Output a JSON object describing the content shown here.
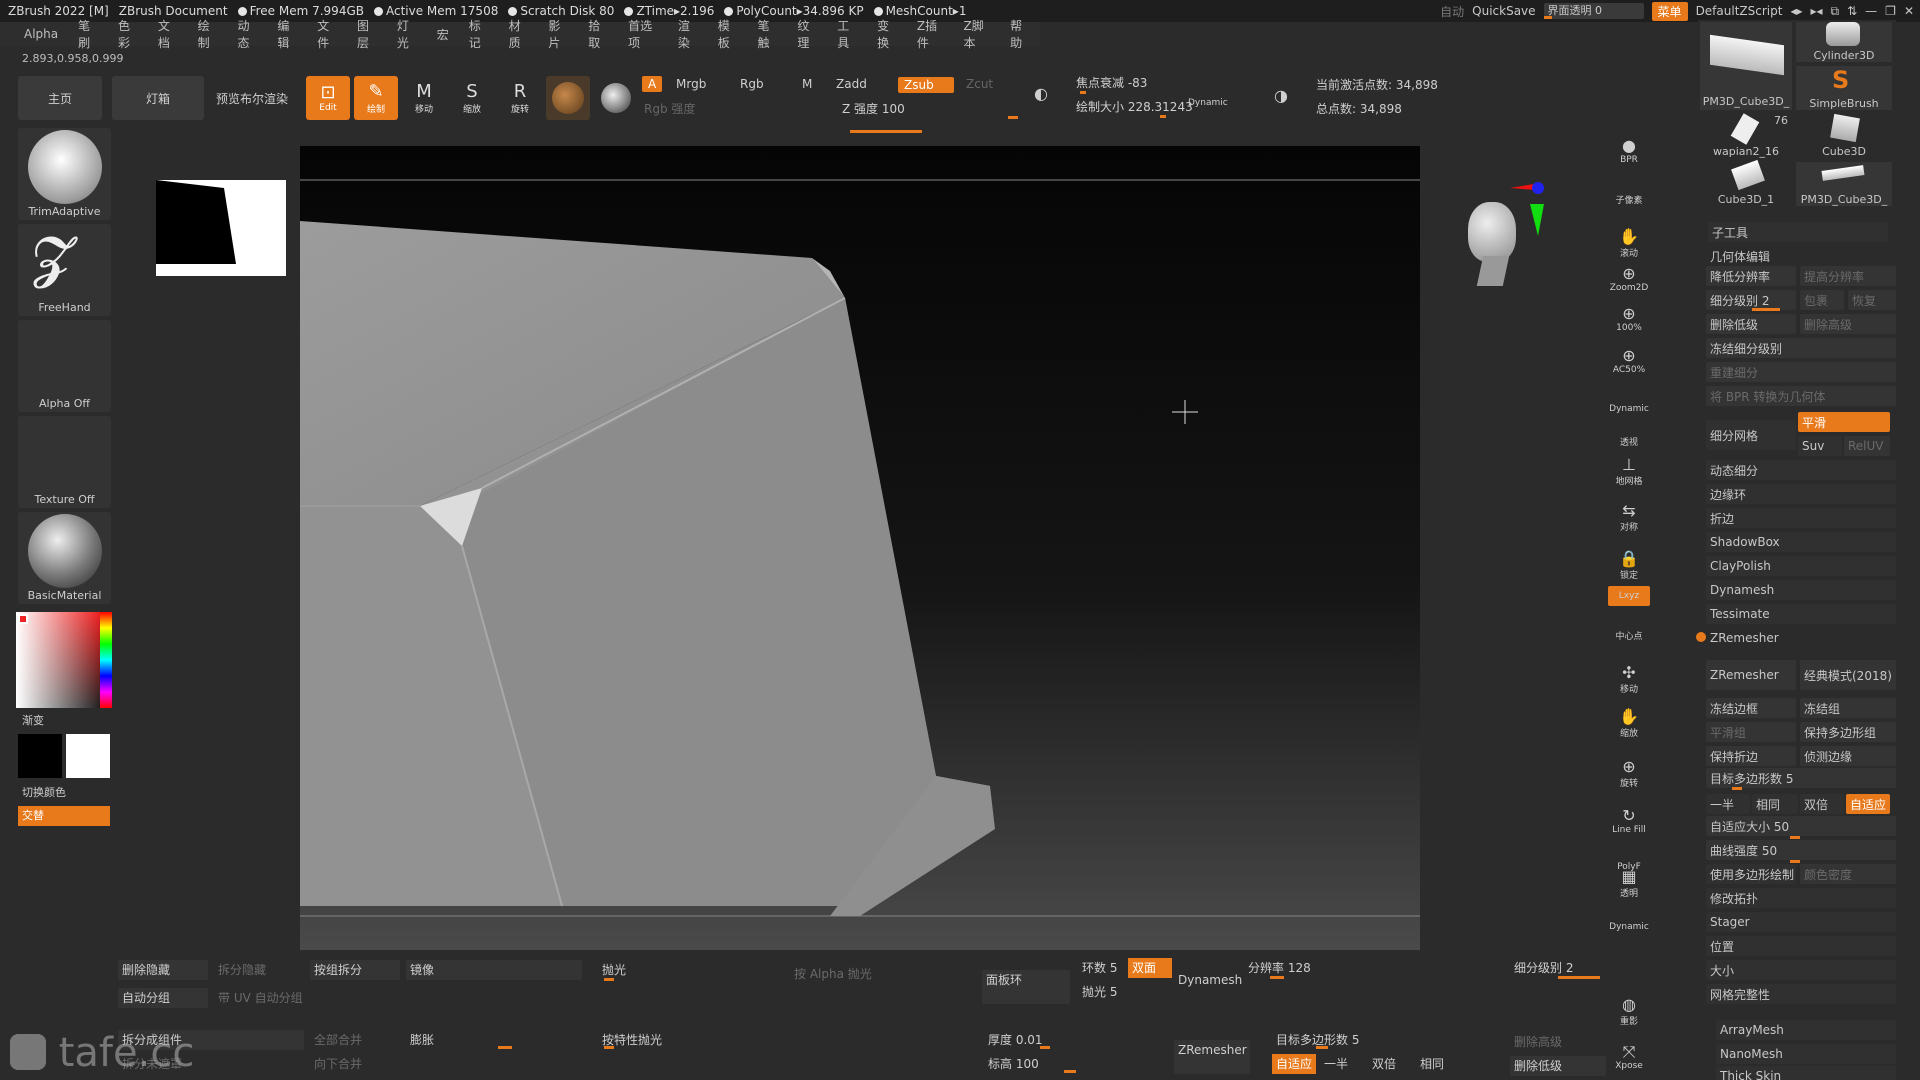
{
  "titlebar": {
    "app": "ZBrush 2022 [M]",
    "doc": "ZBrush Document",
    "free_mem": "Free Mem 7.994GB",
    "active_mem": "Active Mem 17508",
    "scratch": "Scratch Disk 80",
    "ztime": "ZTime▸2.196",
    "polycount": "PolyCount▸34.896 KP",
    "meshcount": "MeshCount▸1",
    "auto": "自动",
    "quicksave": "QuickSave",
    "transparency": "界面透明 0",
    "menu": "菜单",
    "script": "DefaultZScript"
  },
  "menubar": [
    "Alpha",
    "笔刷",
    "色彩",
    "文档",
    "绘制",
    "动态",
    "编辑",
    "文件",
    "图层",
    "灯光",
    "宏",
    "标记",
    "材质",
    "影片",
    "拾取",
    "首选项",
    "渲染",
    "模板",
    "笔触",
    "纹理",
    "工具",
    "变换",
    "Z插件",
    "Z脚本",
    "帮助"
  ],
  "coords": "2.893,0.958,0.999",
  "toolbar": {
    "home": "主页",
    "lightbox": "灯箱",
    "preview_bool": "预览布尔渲染",
    "edit": "Edit",
    "draw": "绘制",
    "move": "移动",
    "scale": "缩放",
    "rotate": "旋转",
    "a": "A",
    "mrgb": "Mrgb",
    "rgb": "Rgb",
    "m": "M",
    "rgb_intensity": "Rgb 强度",
    "zadd": "Zadd",
    "zsub": "Zsub",
    "zcut": "Zcut",
    "z_intensity": "Z 强度 100",
    "focal": "焦点衰减 -83",
    "draw_size": "绘制大小 228.31243",
    "dynamic": "Dynamic",
    "active_points": "当前激活点数: 34,898",
    "total_points": "总点数: 34,898"
  },
  "left": {
    "brush": "TrimAdaptive",
    "stroke": "FreeHand",
    "alpha": "Alpha Off",
    "texture": "Texture Off",
    "material": "BasicMaterial",
    "gradient": "渐变",
    "switch_color": "切换颜色",
    "alternate": "交替"
  },
  "shelf": [
    "BPR",
    "子像素",
    "滚动",
    "Zoom2D",
    "100%",
    "AC50%",
    "Dynamic",
    "透视",
    "地网格",
    "对称",
    "锁定",
    "Lxyz",
    "中心点",
    "移动",
    "缩放",
    "旋转",
    "Line Fill",
    "PolyF",
    "透明",
    "Dynamic",
    "重影",
    "Xpose"
  ],
  "right": {
    "thumbs": [
      "Cylinder3D",
      "PM3D_Cube3D_",
      "SimpleBrush",
      "wapian2_16",
      "Cube3D",
      "Cube3D_1",
      "PM3D_Cube3D_"
    ],
    "thumb_badge": "76",
    "subtool": "子工具",
    "geometry": "几何体编辑",
    "lower_res": "降低分辨率",
    "higher_res": "提高分辨率",
    "sdiv": "细分级别 2",
    "cage": "包裹",
    "reconstruct": "恢复",
    "del_lower": "删除低级",
    "del_higher": "删除高级",
    "freeze_sub": "冻结细分级别",
    "rebuild_sub": "重建细分",
    "bpr_convert": "将 BPR 转换为几何体",
    "divide": "细分网格",
    "smooth": "平滑",
    "suv": "Suv",
    "reluv": "RelUV",
    "dynamic_sub": "动态细分",
    "edge_loop": "边缘环",
    "crease": "折边",
    "shadowbox": "ShadowBox",
    "claypolish": "ClayPolish",
    "dynamesh": "Dynamesh",
    "tessimate": "Tessimate",
    "zremesher_section": "ZRemesher",
    "zremesher": "ZRemesher",
    "legacy": "经典模式(2018)",
    "freeze_border": "冻结边框",
    "freeze_groups": "冻结组",
    "smooth_groups": "平滑组",
    "keep_groups": "保持多边形组",
    "keep_creases": "保持折边",
    "detect_edges": "侦测边缘",
    "target_poly": "目标多边形数 5",
    "half": "一半",
    "same": "相同",
    "double": "双倍",
    "adapt": "自适应",
    "adapt_size": "自适应大小 50",
    "curve_strength": "曲线强度 50",
    "use_polypaint": "使用多边形绘制",
    "color_density": "颜色密度",
    "modify_topo": "修改拓扑",
    "stager": "Stager",
    "position": "位置",
    "size": "大小",
    "mesh_integrity": "网格完整性",
    "arraymesh": "ArrayMesh",
    "nanomesh": "NanoMesh",
    "thickskin": "Thick Skin"
  },
  "bottom": {
    "del_hidden": "删除隐藏",
    "split_hidden": "拆分隐藏",
    "group_split": "按组拆分",
    "mirror": "镜像",
    "polish": "抛光",
    "polish_alpha": "按 Alpha 抛光",
    "panel_loops": "面板环",
    "loops": "环数 5",
    "double_sided": "双面",
    "polish2": "抛光 5",
    "dynamesh": "Dynamesh",
    "resolution": "分辨率 128",
    "sdiv": "细分级别 2",
    "auto_groups": "自动分组",
    "uv_groups": "带 UV 自动分组",
    "split_parts": "拆分成组件",
    "merge_all": "全部合并",
    "merge_down": "向下合并",
    "inflate": "膨胀",
    "polish_features": "按特性抛光",
    "thickness": "厚度 0.01",
    "elevation": "标高 100",
    "zremesher": "ZRemesher",
    "target_poly": "目标多边形数 5",
    "adapt": "自适应",
    "half": "一半",
    "double": "双倍",
    "same": "相同",
    "del_higher": "删除高级",
    "del_lower": "删除低级",
    "split_unmasked": "拆分未遮罩",
    "watermark": "tafe.cc"
  },
  "colors": {
    "accent": "#e87a1b",
    "bg": "#2b2b2b"
  }
}
